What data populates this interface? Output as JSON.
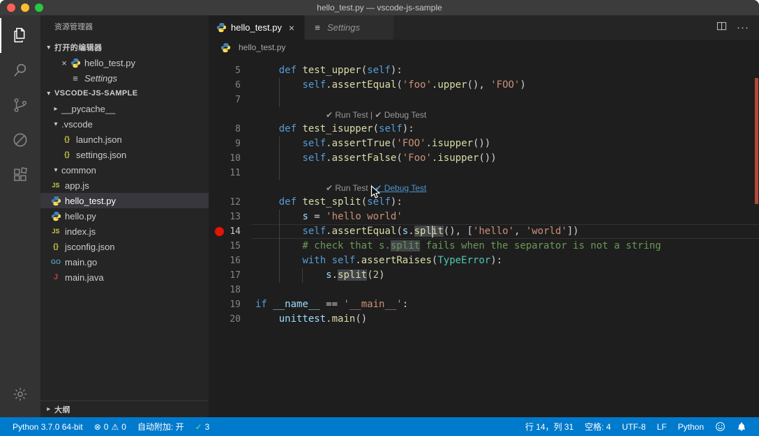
{
  "window": {
    "title": "hello_test.py — vscode-js-sample"
  },
  "activity_bar": {
    "items": [
      {
        "name": "explorer",
        "icon": "explorer",
        "active": true
      },
      {
        "name": "search",
        "icon": "search",
        "active": false
      },
      {
        "name": "source-control",
        "icon": "scm",
        "active": false
      },
      {
        "name": "circle-slash",
        "icon": "circleslash",
        "active": false
      },
      {
        "name": "extensions",
        "icon": "extensions",
        "active": false
      }
    ],
    "bottom": [
      {
        "name": "settings-gear",
        "icon": "gear"
      }
    ]
  },
  "sidebar": {
    "title": "资源管理器",
    "open_editors": {
      "label": "打开的编辑器",
      "items": [
        {
          "icon": "python",
          "label": "hello_test.py",
          "close": true,
          "italic": false
        },
        {
          "icon": "settings",
          "label": "Settings",
          "close": false,
          "italic": true
        }
      ]
    },
    "tree": {
      "root": "VSCODE-JS-SAMPLE",
      "items": [
        {
          "label": "__pycache__",
          "kind": "folder",
          "state": "collapsed",
          "indent": 0
        },
        {
          "label": ".vscode",
          "kind": "folder",
          "state": "expanded",
          "indent": 0
        },
        {
          "label": "launch.json",
          "kind": "json",
          "indent": 1
        },
        {
          "label": "settings.json",
          "kind": "json",
          "indent": 1
        },
        {
          "label": "common",
          "kind": "folder",
          "state": "expanded",
          "indent": 0
        },
        {
          "label": "app.js",
          "kind": "js",
          "indent": 0
        },
        {
          "label": "hello_test.py",
          "kind": "python",
          "indent": 0,
          "selected": true
        },
        {
          "label": "hello.py",
          "kind": "python",
          "indent": 0
        },
        {
          "label": "index.js",
          "kind": "js",
          "indent": 0
        },
        {
          "label": "jsconfig.json",
          "kind": "json",
          "indent": 0
        },
        {
          "label": "main.go",
          "kind": "go",
          "indent": 0
        },
        {
          "label": "main.java",
          "kind": "java",
          "indent": 0
        }
      ]
    },
    "outline": {
      "label": "大纲"
    }
  },
  "editor": {
    "tabs": [
      {
        "label": "hello_test.py",
        "icon": "python",
        "active": true,
        "close": true,
        "italic": false
      },
      {
        "label": "Settings",
        "icon": "settings",
        "active": false,
        "close": false,
        "italic": true
      }
    ],
    "breadcrumb": [
      {
        "icon": "python",
        "label": "hello_test.py"
      }
    ],
    "rows": [
      {
        "n": 5,
        "segs": [
          [
            "    ",
            "pln"
          ],
          [
            "def",
            "kw"
          ],
          [
            " ",
            "pln"
          ],
          [
            "test_upper",
            "fn"
          ],
          [
            "(",
            "pln"
          ],
          [
            "self",
            "slf"
          ],
          [
            "):",
            "pln"
          ]
        ]
      },
      {
        "n": 6,
        "g": [
          4
        ],
        "segs": [
          [
            "        ",
            "pln"
          ],
          [
            "self",
            "slf"
          ],
          [
            ".",
            "pln"
          ],
          [
            "assertEqual",
            "fn"
          ],
          [
            "(",
            "pln"
          ],
          [
            "'foo'",
            "str"
          ],
          [
            ".",
            "pln"
          ],
          [
            "upper",
            "fn"
          ],
          [
            "(), ",
            "pln"
          ],
          [
            "'FOO'",
            "str"
          ],
          [
            ")",
            "pln"
          ]
        ]
      },
      {
        "n": 7,
        "g": [
          4
        ],
        "segs": []
      },
      {
        "lens": [
          {
            "text": "✔ Run Test",
            "link": false
          },
          {
            "text": " | ",
            "sep": true
          },
          {
            "text": "✔ Debug Test",
            "link": false
          }
        ]
      },
      {
        "n": 8,
        "segs": [
          [
            "    ",
            "pln"
          ],
          [
            "def",
            "kw"
          ],
          [
            " ",
            "pln"
          ],
          [
            "test_isupper",
            "fn"
          ],
          [
            "(",
            "pln"
          ],
          [
            "self",
            "slf"
          ],
          [
            "):",
            "pln"
          ]
        ]
      },
      {
        "n": 9,
        "g": [
          4
        ],
        "segs": [
          [
            "        ",
            "pln"
          ],
          [
            "self",
            "slf"
          ],
          [
            ".",
            "pln"
          ],
          [
            "assertTrue",
            "fn"
          ],
          [
            "(",
            "pln"
          ],
          [
            "'FOO'",
            "str"
          ],
          [
            ".",
            "pln"
          ],
          [
            "isupper",
            "fn"
          ],
          [
            "())",
            "pln"
          ]
        ]
      },
      {
        "n": 10,
        "g": [
          4
        ],
        "segs": [
          [
            "        ",
            "pln"
          ],
          [
            "self",
            "slf"
          ],
          [
            ".",
            "pln"
          ],
          [
            "assertFalse",
            "fn"
          ],
          [
            "(",
            "pln"
          ],
          [
            "'Foo'",
            "str"
          ],
          [
            ".",
            "pln"
          ],
          [
            "isupper",
            "fn"
          ],
          [
            "())",
            "pln"
          ]
        ]
      },
      {
        "n": 11,
        "g": [
          4
        ],
        "segs": []
      },
      {
        "lens": [
          {
            "text": "✔ Run Test",
            "link": false
          },
          {
            "text": " | ",
            "sep": true
          },
          {
            "text": "✔ Debug Test",
            "link": true
          }
        ]
      },
      {
        "n": 12,
        "segs": [
          [
            "    ",
            "pln"
          ],
          [
            "def",
            "kw"
          ],
          [
            " ",
            "pln"
          ],
          [
            "test_split",
            "fn"
          ],
          [
            "(",
            "pln"
          ],
          [
            "self",
            "slf"
          ],
          [
            "):",
            "pln"
          ]
        ]
      },
      {
        "n": 13,
        "g": [
          4
        ],
        "segs": [
          [
            "        ",
            "pln"
          ],
          [
            "s",
            "var"
          ],
          [
            " = ",
            "pln"
          ],
          [
            "'hello world'",
            "str"
          ]
        ]
      },
      {
        "n": 14,
        "g": [
          4
        ],
        "cur": true,
        "bp": true,
        "caret": 30,
        "segs": [
          [
            "        ",
            "pln"
          ],
          [
            "self",
            "slf"
          ],
          [
            ".",
            "pln"
          ],
          [
            "assertEqual",
            "fn"
          ],
          [
            "(",
            "pln"
          ],
          [
            "s",
            "var"
          ],
          [
            ".",
            "pln"
          ],
          [
            "split",
            "fn",
            true
          ],
          [
            "(), [",
            "pln"
          ],
          [
            "'hello'",
            "str"
          ],
          [
            ", ",
            "pln"
          ],
          [
            "'world'",
            "str"
          ],
          [
            "])",
            "pln"
          ]
        ]
      },
      {
        "n": 15,
        "g": [
          4
        ],
        "segs": [
          [
            "        # check that s.",
            "cmt"
          ],
          [
            "split",
            "cmt",
            true
          ],
          [
            " fails when the separator is not a string",
            "cmt"
          ]
        ]
      },
      {
        "n": 16,
        "g": [
          4
        ],
        "segs": [
          [
            "        ",
            "pln"
          ],
          [
            "with",
            "kw"
          ],
          [
            " ",
            "pln"
          ],
          [
            "self",
            "slf"
          ],
          [
            ".",
            "pln"
          ],
          [
            "assertRaises",
            "fn"
          ],
          [
            "(",
            "pln"
          ],
          [
            "TypeError",
            "cls"
          ],
          [
            "):",
            "pln"
          ]
        ]
      },
      {
        "n": 17,
        "g": [
          4,
          8
        ],
        "segs": [
          [
            "            ",
            "pln"
          ],
          [
            "s",
            "var"
          ],
          [
            ".",
            "pln"
          ],
          [
            "split",
            "fn",
            true
          ],
          [
            "(",
            "pln"
          ],
          [
            "2",
            "num"
          ],
          [
            ")",
            "pln"
          ]
        ]
      },
      {
        "n": 18,
        "segs": []
      },
      {
        "n": 19,
        "segs": [
          [
            "if",
            "kw"
          ],
          [
            " ",
            "pln"
          ],
          [
            "__name__",
            "var"
          ],
          [
            " == ",
            "pln"
          ],
          [
            "'__main__'",
            "str"
          ],
          [
            ":",
            "pln"
          ]
        ]
      },
      {
        "n": 20,
        "segs": [
          [
            "    ",
            "pln"
          ],
          [
            "unittest",
            "var"
          ],
          [
            ".",
            "pln"
          ],
          [
            "main",
            "fn"
          ],
          [
            "()",
            "pln"
          ]
        ]
      }
    ]
  },
  "status_bar": {
    "left": [
      {
        "name": "python-interpreter",
        "text": "Python 3.7.0 64-bit"
      },
      {
        "name": "problems",
        "parts": [
          {
            "icon": "error"
          },
          {
            "text": "0"
          },
          {
            "icon": "warning"
          },
          {
            "text": "0"
          }
        ]
      },
      {
        "name": "auto-attach",
        "text": "自动附加: 开"
      },
      {
        "name": "test-status",
        "green": true,
        "parts": [
          {
            "icon": "check"
          },
          {
            "text": "3"
          }
        ]
      }
    ],
    "right": [
      {
        "name": "cursor-position",
        "text": "行 14，列 31"
      },
      {
        "name": "indentation",
        "text": "空格: 4"
      },
      {
        "name": "encoding",
        "text": "UTF-8"
      },
      {
        "name": "eol",
        "text": "LF"
      },
      {
        "name": "language-mode",
        "text": "Python"
      },
      {
        "name": "feedback",
        "icon": "smiley"
      },
      {
        "name": "notifications",
        "icon": "bell"
      }
    ]
  },
  "colors": {
    "status_bar": "#007acc",
    "breakpoint": "#e51400",
    "keyword": "#569cd6",
    "function": "#dcdcaa",
    "string": "#ce9178",
    "comment": "#6a9955",
    "number": "#b5cea8",
    "class": "#4ec9b0",
    "variable": "#9cdcfe",
    "codelens_link": "#4e94ce",
    "tree_selection": "#37373d",
    "overview_marker": "#b1483a"
  }
}
